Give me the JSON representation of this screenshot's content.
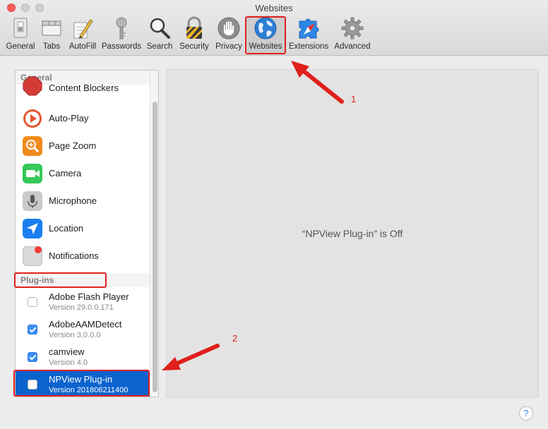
{
  "window": {
    "title": "Websites"
  },
  "toolbar": {
    "items": [
      {
        "label": "General",
        "icon": "general-switch-icon"
      },
      {
        "label": "Tabs",
        "icon": "tabs-icon"
      },
      {
        "label": "AutoFill",
        "icon": "autofill-pencil-icon"
      },
      {
        "label": "Passwords",
        "icon": "key-icon"
      },
      {
        "label": "Search",
        "icon": "magnifier-icon"
      },
      {
        "label": "Security",
        "icon": "padlock-icon"
      },
      {
        "label": "Privacy",
        "icon": "hand-icon"
      },
      {
        "label": "Websites",
        "icon": "globe-icon",
        "selected": true
      },
      {
        "label": "Extensions",
        "icon": "puzzle-icon"
      },
      {
        "label": "Advanced",
        "icon": "gear-icon"
      }
    ]
  },
  "sidebar": {
    "general_header": "General",
    "general_items": [
      {
        "label": "Content Blockers",
        "icon": "stop-sign-icon",
        "color": "#d33b36"
      },
      {
        "label": "Auto-Play",
        "icon": "play-icon",
        "color": "#e2562e"
      },
      {
        "label": "Page Zoom",
        "icon": "zoom-icon",
        "color": "#f08a1b"
      },
      {
        "label": "Camera",
        "icon": "camera-icon",
        "color": "#34c759"
      },
      {
        "label": "Microphone",
        "icon": "microphone-icon",
        "color": "#a3a3a3"
      },
      {
        "label": "Location",
        "icon": "location-arrow-icon",
        "color": "#1a7ef0"
      },
      {
        "label": "Notifications",
        "icon": "notifications-icon",
        "color": "#bdbdbd"
      }
    ],
    "plugins_header": "Plug-ins",
    "plugins": [
      {
        "name": "Adobe Flash Player",
        "version": "Version 29.0.0.171",
        "checked": false
      },
      {
        "name": "AdobeAAMDetect",
        "version": "Version 3.0.0.0",
        "checked": true
      },
      {
        "name": "camview",
        "version": "Version 4.0",
        "checked": true
      },
      {
        "name": "NPView Plug-in",
        "version": "Version 201806211400",
        "checked": false,
        "selected": true
      }
    ]
  },
  "detail": {
    "message": "“NPView Plug-in” is Off"
  },
  "annotations": {
    "one": "1",
    "two": "2"
  },
  "help": {
    "label": "?"
  },
  "colors": {
    "accent": "#0b63ce",
    "annotation": "#e0201c"
  }
}
